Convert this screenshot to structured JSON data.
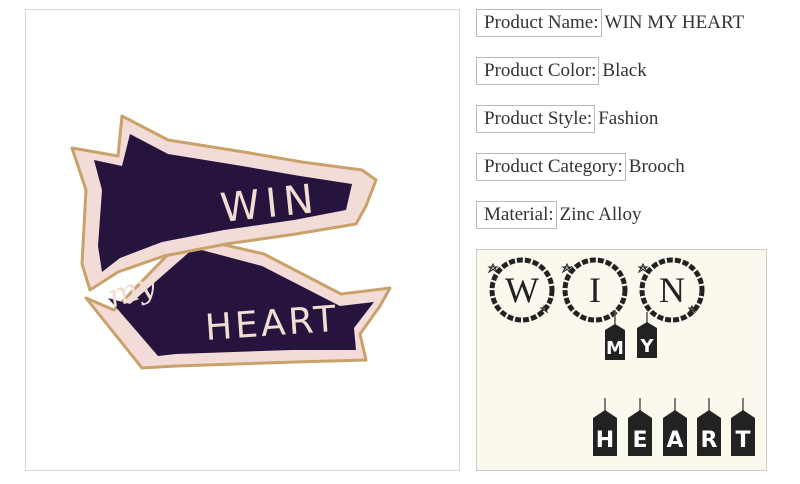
{
  "specs": {
    "product_name": {
      "label": "Product Name:",
      "value": "WIN MY HEART"
    },
    "product_color": {
      "label": "Product Color:",
      "value": "Black"
    },
    "product_style": {
      "label": "Product Style:",
      "value": "Fashion"
    },
    "product_category": {
      "label": "Product Category:",
      "value": "Brooch"
    },
    "material": {
      "label": "Material:",
      "value": "Zinc Alloy"
    }
  },
  "brooch": {
    "text_win": "WIN",
    "text_my": "my",
    "text_heart": "HEART",
    "colors": {
      "enamel": "#26143f",
      "border": "#f1d9d5",
      "gold": "#c8a26a"
    }
  },
  "decoration": {
    "ring_letters": [
      "W",
      "I",
      "N"
    ],
    "my_tags": [
      "M",
      "Y"
    ],
    "heart_tags": [
      "H",
      "E",
      "A",
      "R",
      "T"
    ]
  }
}
